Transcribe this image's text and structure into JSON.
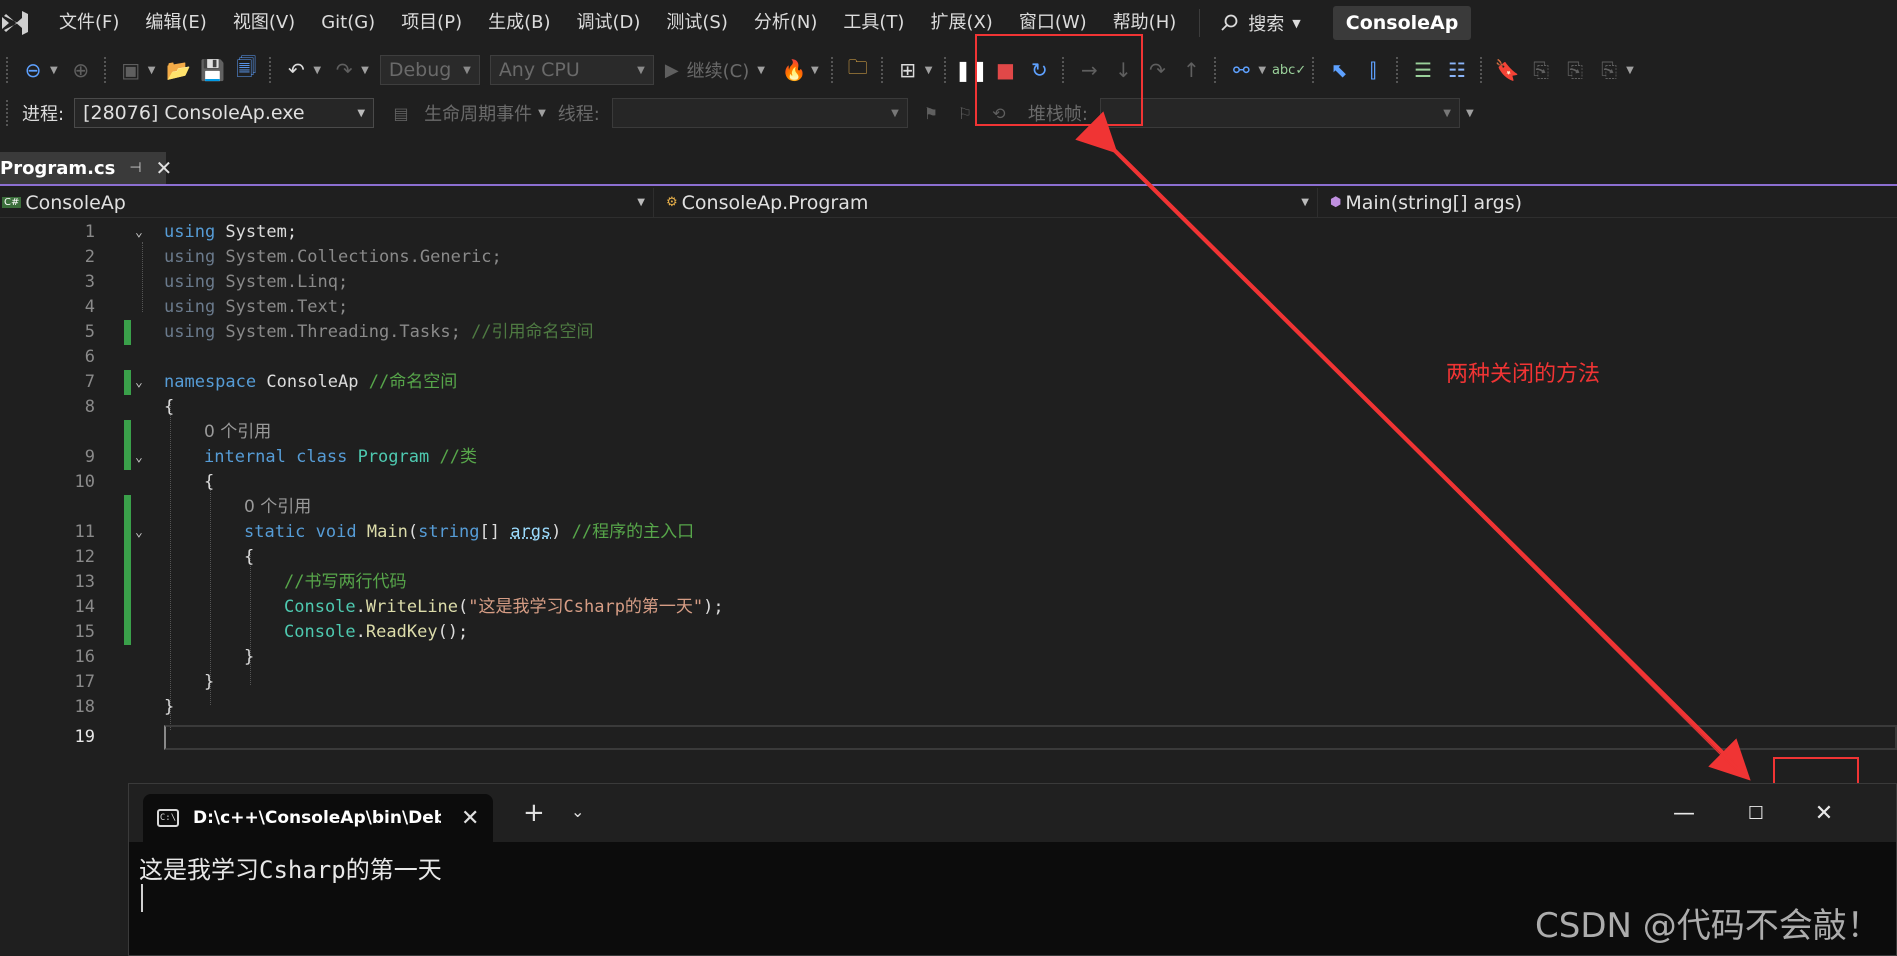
{
  "menubar": {
    "items": [
      "文件(F)",
      "编辑(E)",
      "视图(V)",
      "Git(G)",
      "项目(P)",
      "生成(B)",
      "调试(D)",
      "测试(S)",
      "分析(N)",
      "工具(T)",
      "扩展(X)",
      "窗口(W)",
      "帮助(H)"
    ],
    "search_label": "搜索",
    "solution_name": "ConsoleAp"
  },
  "toolbar": {
    "config": "Debug",
    "platform": "Any CPU",
    "continue_label": "继续(C)"
  },
  "debugbar": {
    "process_label": "进程:",
    "process_value": "[28076] ConsoleAp.exe",
    "lifecycle_label": "生命周期事件",
    "thread_label": "线程:",
    "stackframe_label": "堆栈帧:"
  },
  "tab": {
    "filename": "Program.cs"
  },
  "navbar": {
    "project": "ConsoleAp",
    "class": "ConsoleAp.Program",
    "member": "Main(string[] args)"
  },
  "code": {
    "l1": "using System;",
    "l2_kw": "using",
    "l2_rest": " System.Collections.Generic;",
    "l3_kw": "using",
    "l3_rest": " System.Linq;",
    "l4_kw": "using",
    "l4_rest": " System.Text;",
    "l5_kw": "using",
    "l5_rest": " System.Threading.Tasks; ",
    "l5_cmt": "//引用命名空间",
    "l7_kw": "namespace",
    "l7_name": " ConsoleAp ",
    "l7_cmt": "//命名空间",
    "open_brace": "{",
    "close_brace": "}",
    "ref_count": "0 个引用",
    "l9_kw1": "internal",
    "l9_kw2": "class",
    "l9_type": "Program",
    "l9_cmt": "//类",
    "l11_kw1": "static",
    "l11_kw2": "void",
    "l11_meth": "Main",
    "l11_p1": "(",
    "l11_kw3": "string",
    "l11_p2": "[] ",
    "l11_param": "args",
    "l11_p3": ") ",
    "l11_cmt": "//程序的主入口",
    "l13_cmt": "//书写两行代码",
    "l14_type": "Console",
    "l14_dot": ".",
    "l14_meth": "WriteLine",
    "l14_p1": "(",
    "l14_str": "\"这是我学习Csharp的第一天\"",
    "l14_p2": ");",
    "l15_type": "Console",
    "l15_dot": ".",
    "l15_meth": "ReadKey",
    "l15_p": "();"
  },
  "line_numbers": [
    "1",
    "2",
    "3",
    "4",
    "5",
    "6",
    "7",
    "8",
    "9",
    "10",
    "11",
    "12",
    "13",
    "14",
    "15",
    "16",
    "17",
    "18",
    "19"
  ],
  "annotation": {
    "text": "两种关闭的方法",
    "color": "#f03434"
  },
  "console": {
    "tab_title": "D:\\c++\\ConsoleAp\\bin\\Debug",
    "icon_text": "C:\\",
    "output": "这是我学习Csharp的第一天"
  },
  "watermark": "CSDN @代码不会敲！"
}
